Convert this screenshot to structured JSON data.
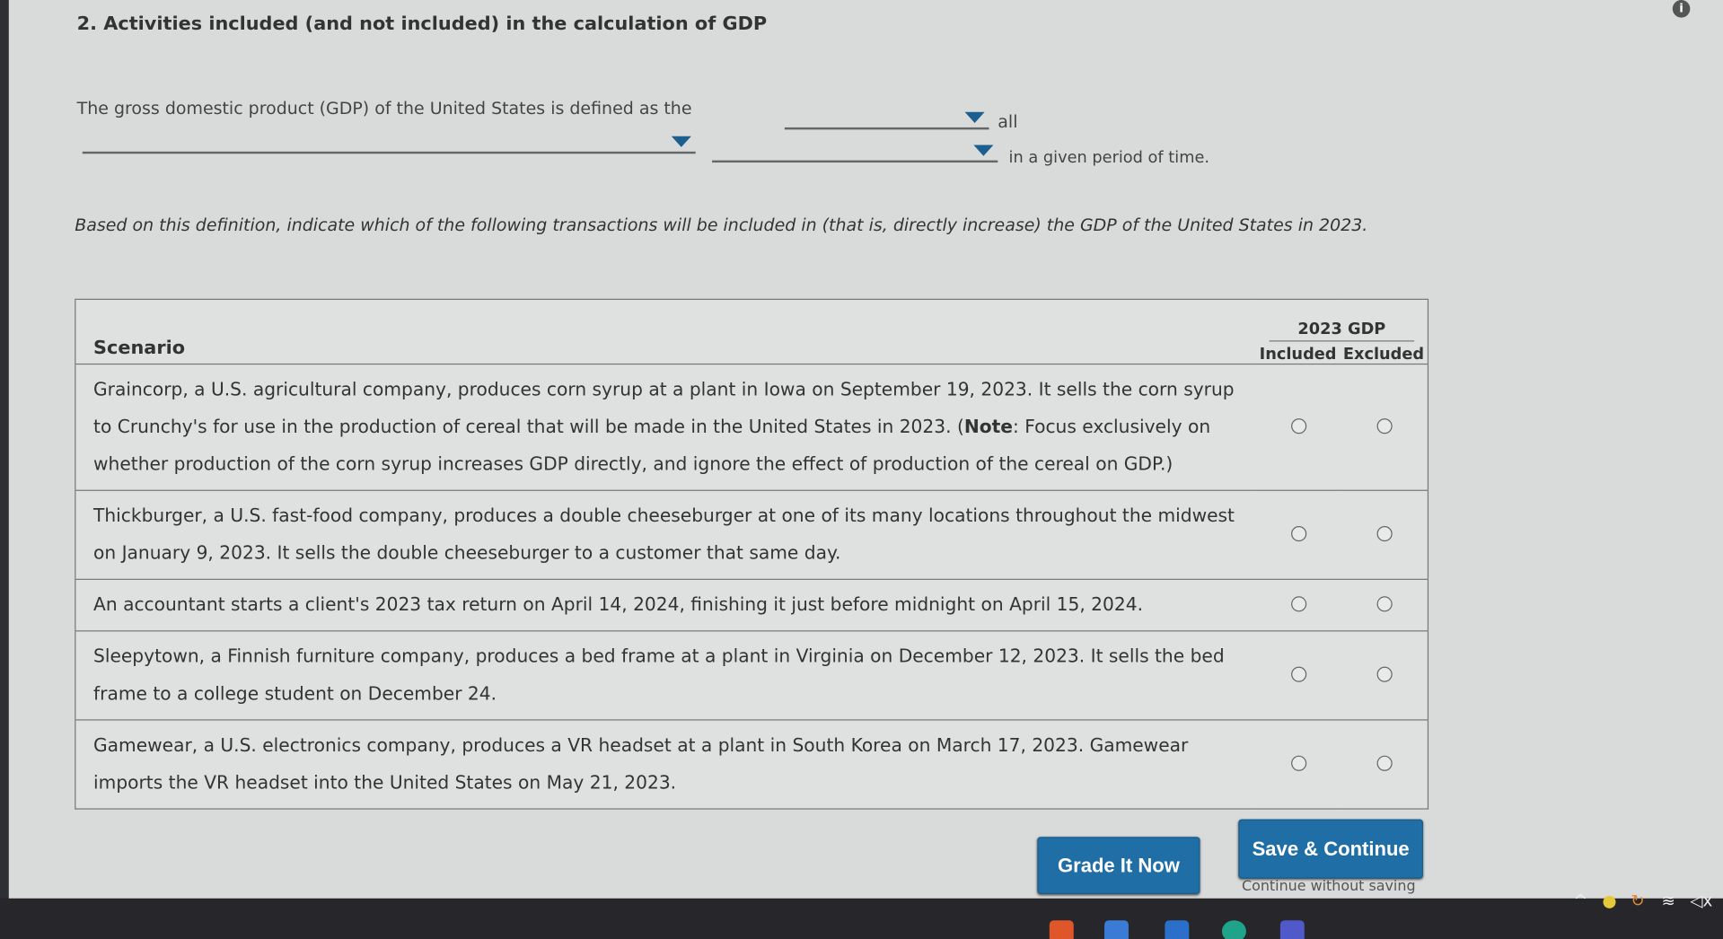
{
  "question": {
    "title": "2. Activities included (and not included) in the calculation of GDP",
    "definition": {
      "text_start": "The gross domestic product (GDP) of the United States is defined as the",
      "dropdown_1_value": "",
      "text_all": "all",
      "dropdown_2_value": "",
      "dropdown_3_value": "",
      "text_end": "in a given period of time."
    },
    "instructions": "Based on this definition, indicate which of the following transactions will be included in (that is, directly increase) the GDP of the United States in 2023."
  },
  "table": {
    "scenario_header": "Scenario",
    "group_header": "2023 GDP",
    "col_included": "Included",
    "col_excluded": "Excluded",
    "rows": [
      {
        "pre": "Graincorp, a U.S. agricultural company, produces corn syrup at a plant in Iowa on September 19, 2023. It sells the corn syrup to Crunchy's for use in the production of cereal that will be made in the United States in 2023. (",
        "note": "Note",
        "post": ": Focus exclusively on whether production of the corn syrup increases GDP directly, and ignore the effect of production of the cereal on GDP.)",
        "selected": null
      },
      {
        "pre": "Thickburger, a U.S. fast-food company, produces a double cheeseburger at one of its many locations throughout the midwest on January 9, 2023. It sells the double cheeseburger to a customer that same day.",
        "selected": null
      },
      {
        "pre": "An accountant starts a client's 2023 tax return on April 14, 2024, finishing it just before midnight on April 15, 2024.",
        "selected": null
      },
      {
        "pre": "Sleepytown, a Finnish furniture company, produces a bed frame at a plant in Virginia on December 12, 2023. It sells the bed frame to a college student on December 24.",
        "selected": null
      },
      {
        "pre": "Gamewear, a U.S. electronics company, produces a VR headset at a plant in South Korea on March 17, 2023. Gamewear imports the VR headset into the United States on May 21, 2023.",
        "selected": null
      }
    ]
  },
  "buttons": {
    "grade": "Grade It Now",
    "save": "Save & Continue",
    "continue_without_saving": "Continue without saving"
  },
  "colors": {
    "button": "#1f6fa6",
    "dropdown_arrow": "#1c5f8f"
  },
  "taskbar": {
    "tray_icons": [
      "chevron-up-icon",
      "cloud-icon",
      "sync-icon",
      "wifi-icon",
      "speaker-muted-icon"
    ]
  }
}
